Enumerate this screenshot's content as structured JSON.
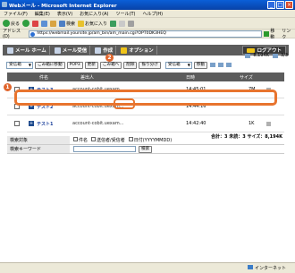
{
  "window": {
    "title": "Webメール - Microsoft Internet Explorer"
  },
  "menu": [
    "ファイル(F)",
    "編集(E)",
    "表示(V)",
    "お気に入り(A)",
    "ツール(T)",
    "ヘルプ(H)"
  ],
  "toolbar": {
    "back": "戻る",
    "search": "検索",
    "favorites": "お気に入り"
  },
  "address": {
    "label": "アドレス(D)",
    "url": "https://webmail.yoursite.jp/am_bin/am_main.cgi?OPT0DK3HEQ",
    "go": "移動",
    "links": "リンク"
  },
  "nav": {
    "items": [
      "メール ホーム",
      "メール受信",
      "作成",
      "オプション"
    ],
    "logout": "ログアウト"
  },
  "actions": {
    "folder_select": "受信箱",
    "move_to_trash": "ごみ箱に移動",
    "pop3": "POP3",
    "update": "更新",
    "empty_trash": "ごみ箱へ",
    "delete": "削除",
    "sort": "振り分け",
    "target_select": "受信箱",
    "move": "移動"
  },
  "info": {
    "quota": "8,194K",
    "page": "3/3"
  },
  "table": {
    "headers": [
      "件名",
      "差出人",
      "日時",
      "サイズ"
    ],
    "rows": [
      {
        "subject": "テスト3",
        "from": "account-cobit.uexam...",
        "date": "14:45:01",
        "size": "7M"
      },
      {
        "subject": "テスト2",
        "from": "account-cobit.uexam...",
        "date": "14:44:16",
        "size": ""
      },
      {
        "subject": "テスト1",
        "from": "account-cobit.uexam...",
        "date": "14:42:40",
        "size": "1K"
      }
    ],
    "summary": "合計：3 未読：3 サイズ：8,194K"
  },
  "search": {
    "target_label": "検索対象",
    "opt_subject": "件名",
    "opt_sender": "送信者/受信者",
    "opt_date": "日付(YYYYMMDD)",
    "keyword_label": "検索キーワード",
    "search_button": "検索"
  },
  "status": {
    "left": "",
    "zone": "インターネット"
  },
  "callouts": [
    "1",
    "2"
  ]
}
